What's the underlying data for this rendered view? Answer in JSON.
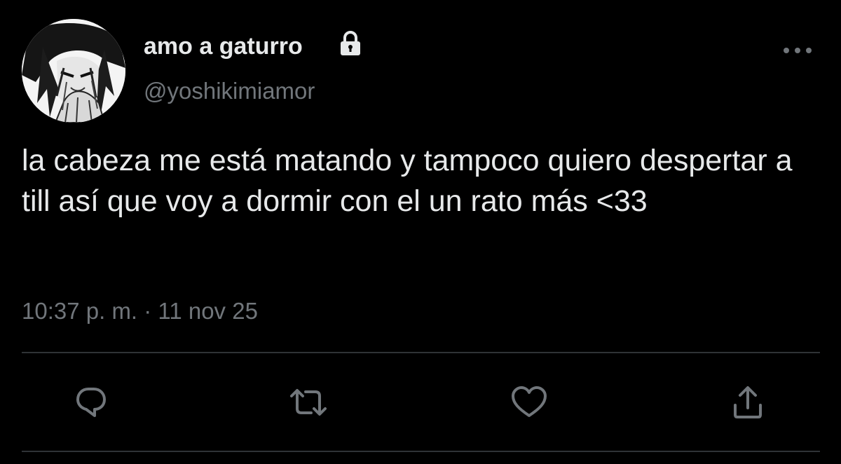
{
  "tweet": {
    "author": {
      "display_name": "amo a gaturro",
      "handle": "@yoshikimiamor",
      "avatar_icon": "user-avatar-manga-drawing",
      "protected_icon": "lock-icon"
    },
    "text": "la cabeza me está matando y tampoco quiero despertar a till así que voy a dormir con el un rato más <33",
    "timestamp": "10:37 p. m. · 11 nov 25",
    "more_icon": "more-options-icon",
    "actions": [
      {
        "name": "reply",
        "icon": "reply-icon"
      },
      {
        "name": "retweet",
        "icon": "retweet-icon"
      },
      {
        "name": "like",
        "icon": "heart-icon"
      },
      {
        "name": "share",
        "icon": "share-icon"
      }
    ]
  },
  "colors": {
    "background": "#000000",
    "primary_text": "#e7e9ea",
    "secondary_text": "#71767b",
    "divider": "#2f3336"
  }
}
